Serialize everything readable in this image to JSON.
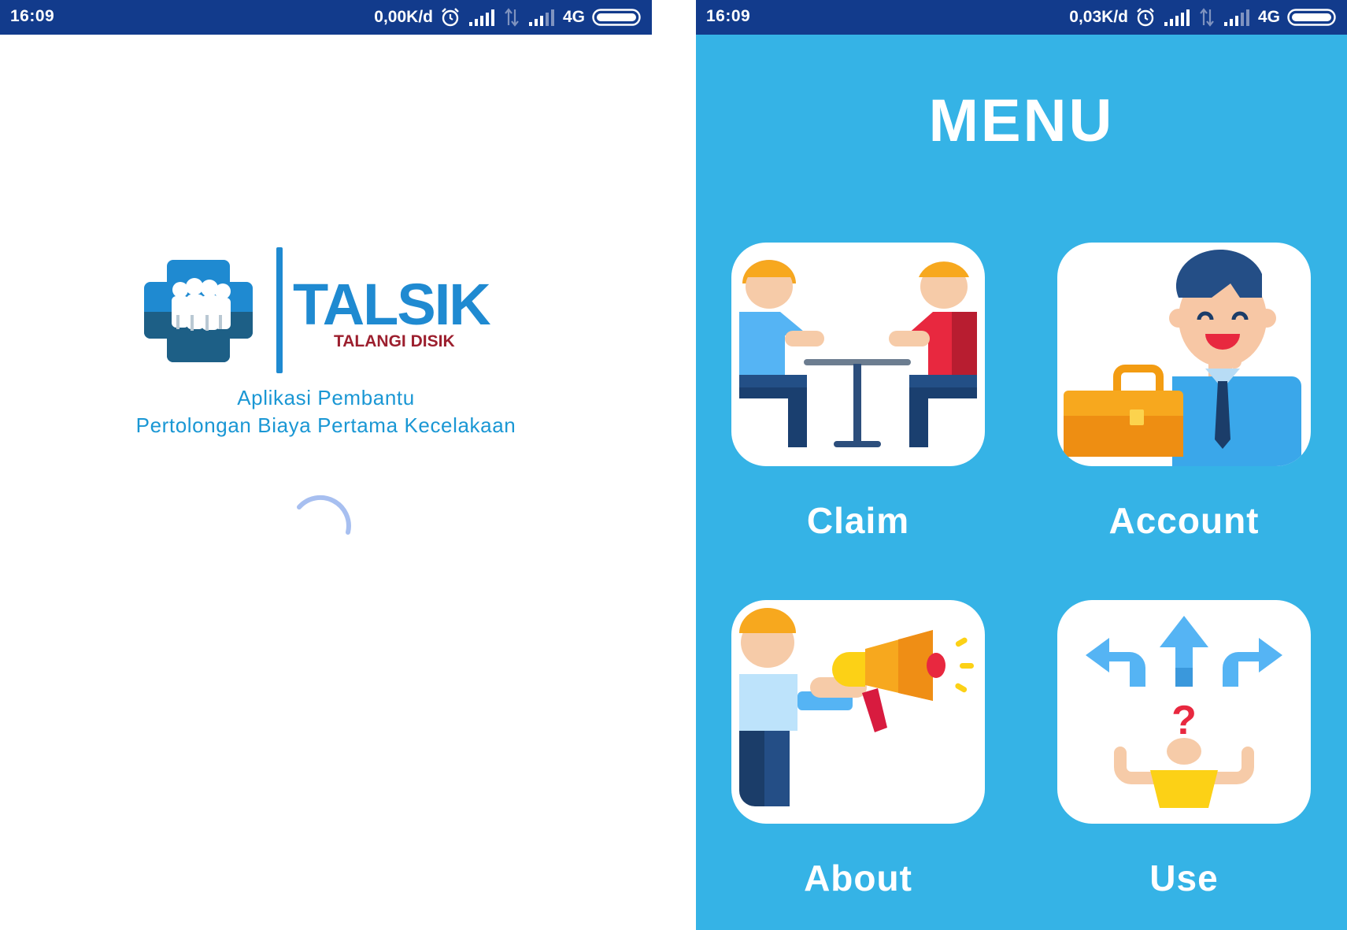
{
  "splash": {
    "status": {
      "time": "16:09",
      "speed": "0,00K/d",
      "network": "4G"
    },
    "logo": {
      "title": "TALSIK",
      "subtitle": "TALANGI DISIK"
    },
    "tagline_line1": "Aplikasi Pembantu",
    "tagline_line2": "Pertolongan Biaya Pertama Kecelakaan"
  },
  "menu_screen": {
    "status": {
      "time": "16:09",
      "speed": "0,03K/d",
      "network": "4G"
    },
    "title": "MENU",
    "items": [
      {
        "label": "Claim",
        "icon": "handshake-meeting-icon"
      },
      {
        "label": "Account",
        "icon": "businessman-briefcase-icon"
      },
      {
        "label": "About",
        "icon": "megaphone-announcement-icon"
      },
      {
        "label": "Use",
        "icon": "direction-question-icon"
      }
    ]
  },
  "colors": {
    "status_bar": "#123b8c",
    "menu_background": "#35b3e6",
    "tagline": "#1a97d4",
    "logo_blue": "#1f8ad1",
    "logo_dark_red": "#9c1f2e"
  }
}
